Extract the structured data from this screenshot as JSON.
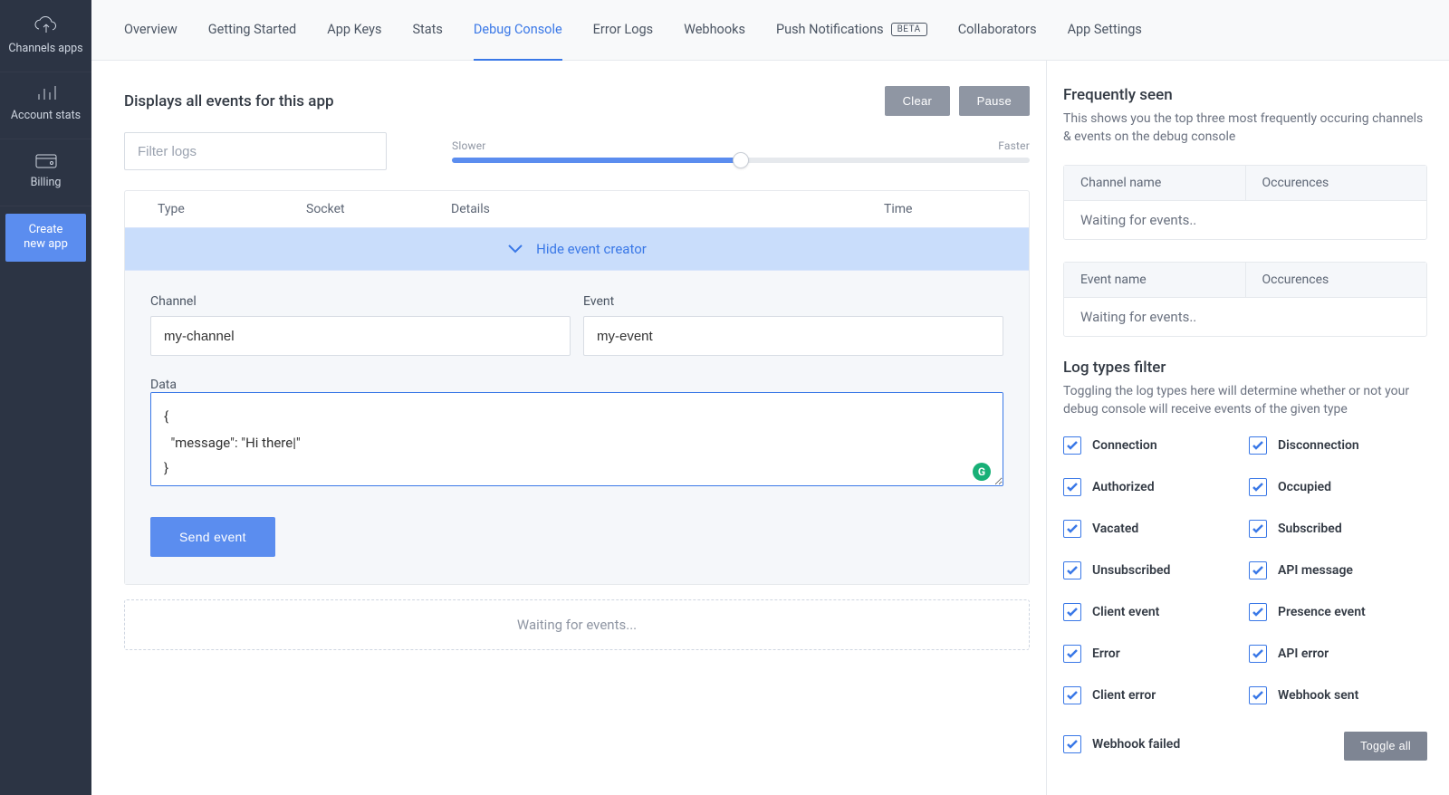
{
  "sidebar": {
    "items": [
      {
        "id": "channels-apps",
        "label": "Channels apps"
      },
      {
        "id": "account-stats",
        "label": "Account stats"
      },
      {
        "id": "billing",
        "label": "Billing"
      }
    ],
    "create_line1": "Create",
    "create_line2": "new app"
  },
  "tabs": [
    {
      "label": "Overview",
      "active": false
    },
    {
      "label": "Getting Started",
      "active": false
    },
    {
      "label": "App Keys",
      "active": false
    },
    {
      "label": "Stats",
      "active": false
    },
    {
      "label": "Debug Console",
      "active": true
    },
    {
      "label": "Error Logs",
      "active": false
    },
    {
      "label": "Webhooks",
      "active": false
    },
    {
      "label": "Push Notifications",
      "active": false,
      "badge": "BETA"
    },
    {
      "label": "Collaborators",
      "active": false
    },
    {
      "label": "App Settings",
      "active": false
    }
  ],
  "left": {
    "title": "Displays all events for this app",
    "clear": "Clear",
    "pause": "Pause",
    "filter_placeholder": "Filter logs",
    "slider": {
      "left": "Slower",
      "right": "Faster"
    },
    "columns": {
      "type": "Type",
      "socket": "Socket",
      "details": "Details",
      "time": "Time"
    },
    "hide_creator": "Hide event creator",
    "form": {
      "channel_label": "Channel",
      "channel_value": "my-channel",
      "event_label": "Event",
      "event_value": "my-event",
      "data_label": "Data",
      "data_value": "{\n  \"message\": \"Hi there|\"\n}",
      "send": "Send event"
    },
    "waiting": "Waiting for events..."
  },
  "right": {
    "freq_title": "Frequently seen",
    "freq_desc": "This shows you the top three most frequently occuring channels & events on the debug console",
    "channel_table": {
      "col1": "Channel name",
      "col2": "Occurences",
      "row": "Waiting for events.."
    },
    "event_table": {
      "col1": "Event name",
      "col2": "Occurences",
      "row": "Waiting for events.."
    },
    "filter_title": "Log types filter",
    "filter_desc": "Toggling the log types here will determine whether or not your debug console will receive events of the given type",
    "filters": [
      "Connection",
      "Disconnection",
      "Authorized",
      "Occupied",
      "Vacated",
      "Subscribed",
      "Unsubscribed",
      "API message",
      "Client event",
      "Presence event",
      "Error",
      "API error",
      "Client error",
      "Webhook sent",
      "Webhook failed"
    ],
    "toggle_all": "Toggle all"
  }
}
